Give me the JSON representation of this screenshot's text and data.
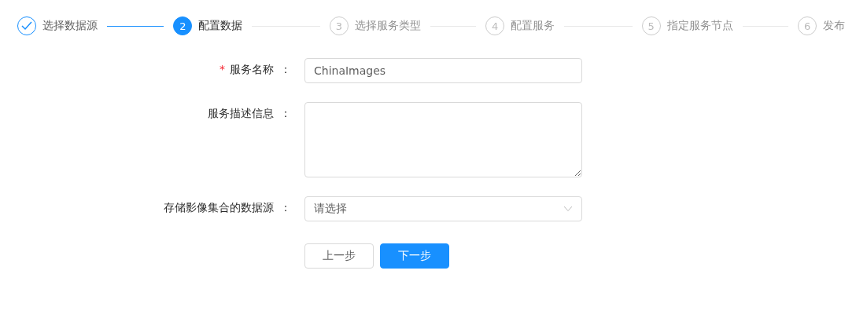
{
  "steps": [
    {
      "title": "选择数据源",
      "done": true,
      "selected": false
    },
    {
      "number": "2",
      "title": "配置数据",
      "done": false,
      "selected": true
    },
    {
      "number": "3",
      "title": "选择服务类型",
      "done": false,
      "selected": false
    },
    {
      "number": "4",
      "title": "配置服务",
      "done": false,
      "selected": false
    },
    {
      "number": "5",
      "title": "指定服务节点",
      "done": false,
      "selected": false
    },
    {
      "number": "6",
      "title": "发布",
      "done": false,
      "selected": false
    }
  ],
  "form": {
    "fields": [
      {
        "kind": "input",
        "required_mark": "*",
        "label": "服务名称",
        "separator": "：",
        "value": "ChinaImages"
      },
      {
        "kind": "textarea",
        "label": "服务描述信息",
        "separator": "："
      },
      {
        "kind": "select",
        "label": "存储影像集合的数据源",
        "separator": "：",
        "placeholder": "请选择"
      }
    ],
    "buttons": [
      {
        "label": "上一步",
        "kind": "default"
      },
      {
        "label": "下一步",
        "kind": "primary"
      }
    ]
  }
}
